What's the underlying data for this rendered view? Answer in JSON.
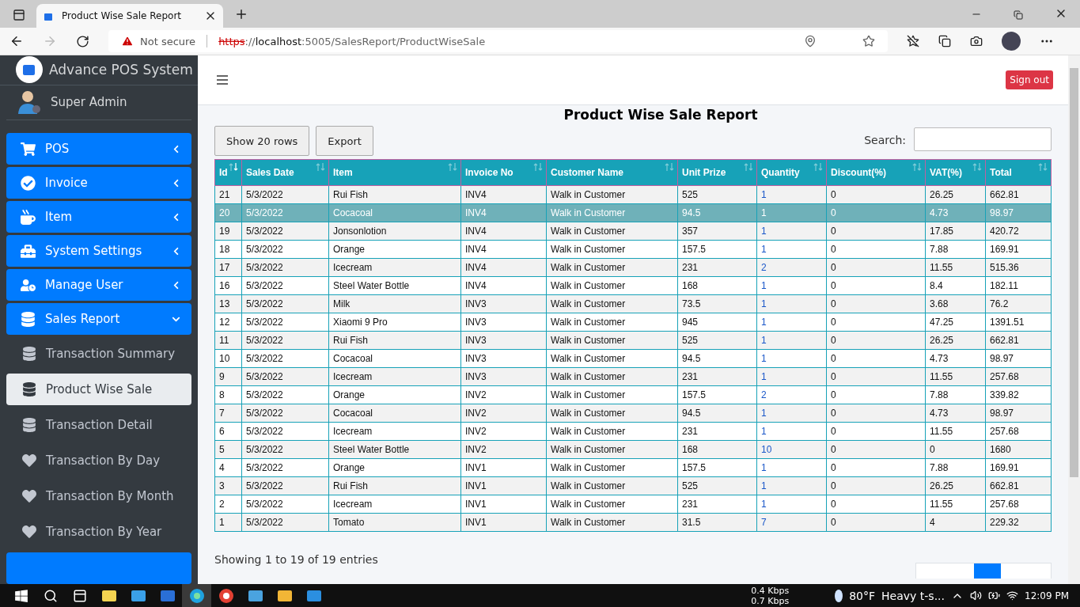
{
  "browser": {
    "tab_title": "Product Wise Sale Report",
    "security": "Not secure",
    "url_scheme": "https",
    "url_sep": "://",
    "url_host": "localhost",
    "url_rest": ":5005/SalesReport/ProductWiseSale"
  },
  "sidebar": {
    "brand": "Advance POS System",
    "user": "Super Admin",
    "menu": [
      {
        "label": "POS",
        "expanded": false
      },
      {
        "label": "Invoice",
        "expanded": false
      },
      {
        "label": "Item",
        "expanded": false
      },
      {
        "label": "System Settings",
        "expanded": false
      },
      {
        "label": "Manage User",
        "expanded": false
      },
      {
        "label": "Sales Report",
        "expanded": true,
        "children": [
          {
            "label": "Transaction Summary",
            "selected": false
          },
          {
            "label": "Product Wise Sale",
            "selected": true
          },
          {
            "label": "Transaction Detail",
            "selected": false
          },
          {
            "label": "Transaction By Day",
            "selected": false
          },
          {
            "label": "Transaction By Month",
            "selected": false
          },
          {
            "label": "Transaction By Year",
            "selected": false
          }
        ]
      }
    ]
  },
  "header": {
    "signout": "Sign out"
  },
  "report": {
    "title": "Product Wise Sale Report",
    "buttons": [
      "Show 20 rows",
      "Export"
    ],
    "search_label": "Search:",
    "columns": [
      {
        "label": "Id",
        "sorted_desc": true
      },
      {
        "label": "Sales Date",
        "sorted_desc": false
      },
      {
        "label": "Item",
        "sorted_desc": false
      },
      {
        "label": "Invoice No",
        "sorted_desc": false
      },
      {
        "label": "Customer Name",
        "sorted_desc": false
      },
      {
        "label": "Unit Prize",
        "sorted_desc": false
      },
      {
        "label": "Quantity",
        "sorted_desc": false
      },
      {
        "label": "Discount(%)",
        "sorted_desc": false
      },
      {
        "label": "VAT(%)",
        "sorted_desc": false
      },
      {
        "label": "Total",
        "sorted_desc": false
      }
    ],
    "rows": [
      {
        "selected": false,
        "cells": [
          "21",
          "5/3/2022",
          "Rui Fish",
          "INV4",
          "Walk in Customer",
          "525",
          "1",
          "0",
          "26.25",
          "662.81"
        ]
      },
      {
        "selected": true,
        "cells": [
          "20",
          "5/3/2022",
          "Cocacoal",
          "INV4",
          "Walk in Customer",
          "94.5",
          "1",
          "0",
          "4.73",
          "98.97"
        ]
      },
      {
        "selected": false,
        "cells": [
          "19",
          "5/3/2022",
          "Jonsonlotion",
          "INV4",
          "Walk in Customer",
          "357",
          "1",
          "0",
          "17.85",
          "420.72"
        ]
      },
      {
        "selected": false,
        "cells": [
          "18",
          "5/3/2022",
          "Orange",
          "INV4",
          "Walk in Customer",
          "157.5",
          "1",
          "0",
          "7.88",
          "169.91"
        ]
      },
      {
        "selected": false,
        "cells": [
          "17",
          "5/3/2022",
          "Icecream",
          "INV4",
          "Walk in Customer",
          "231",
          "2",
          "0",
          "11.55",
          "515.36"
        ]
      },
      {
        "selected": false,
        "cells": [
          "16",
          "5/3/2022",
          "Steel Water Bottle",
          "INV4",
          "Walk in Customer",
          "168",
          "1",
          "0",
          "8.4",
          "182.11"
        ]
      },
      {
        "selected": false,
        "cells": [
          "13",
          "5/3/2022",
          "Milk",
          "INV3",
          "Walk in Customer",
          "73.5",
          "1",
          "0",
          "3.68",
          "76.2"
        ]
      },
      {
        "selected": false,
        "cells": [
          "12",
          "5/3/2022",
          "Xiaomi 9 Pro",
          "INV3",
          "Walk in Customer",
          "945",
          "1",
          "0",
          "47.25",
          "1391.51"
        ]
      },
      {
        "selected": false,
        "cells": [
          "11",
          "5/3/2022",
          "Rui Fish",
          "INV3",
          "Walk in Customer",
          "525",
          "1",
          "0",
          "26.25",
          "662.81"
        ]
      },
      {
        "selected": false,
        "cells": [
          "10",
          "5/3/2022",
          "Cocacoal",
          "INV3",
          "Walk in Customer",
          "94.5",
          "1",
          "0",
          "4.73",
          "98.97"
        ]
      },
      {
        "selected": false,
        "cells": [
          "9",
          "5/3/2022",
          "Icecream",
          "INV3",
          "Walk in Customer",
          "231",
          "1",
          "0",
          "11.55",
          "257.68"
        ]
      },
      {
        "selected": false,
        "cells": [
          "8",
          "5/3/2022",
          "Orange",
          "INV2",
          "Walk in Customer",
          "157.5",
          "2",
          "0",
          "7.88",
          "339.82"
        ]
      },
      {
        "selected": false,
        "cells": [
          "7",
          "5/3/2022",
          "Cocacoal",
          "INV2",
          "Walk in Customer",
          "94.5",
          "1",
          "0",
          "4.73",
          "98.97"
        ]
      },
      {
        "selected": false,
        "cells": [
          "6",
          "5/3/2022",
          "Icecream",
          "INV2",
          "Walk in Customer",
          "231",
          "1",
          "0",
          "11.55",
          "257.68"
        ]
      },
      {
        "selected": false,
        "cells": [
          "5",
          "5/3/2022",
          "Steel Water Bottle",
          "INV2",
          "Walk in Customer",
          "168",
          "10",
          "0",
          "0",
          "1680"
        ]
      },
      {
        "selected": false,
        "cells": [
          "4",
          "5/3/2022",
          "Orange",
          "INV1",
          "Walk in Customer",
          "157.5",
          "1",
          "0",
          "7.88",
          "169.91"
        ]
      },
      {
        "selected": false,
        "cells": [
          "3",
          "5/3/2022",
          "Rui Fish",
          "INV1",
          "Walk in Customer",
          "525",
          "1",
          "0",
          "26.25",
          "662.81"
        ]
      },
      {
        "selected": false,
        "cells": [
          "2",
          "5/3/2022",
          "Icecream",
          "INV1",
          "Walk in Customer",
          "231",
          "1",
          "0",
          "11.55",
          "257.68"
        ]
      },
      {
        "selected": false,
        "cells": [
          "1",
          "5/3/2022",
          "Tomato",
          "INV1",
          "Walk in Customer",
          "31.5",
          "7",
          "0",
          "4",
          "229.32"
        ]
      }
    ],
    "info": "Showing 1 to 19 of 19 entries"
  },
  "taskbar": {
    "download": "0.4 Kbps",
    "upload": "0.7 Kbps",
    "temperature": "80°F",
    "weather": "Heavy t-s...",
    "time": "12:09 PM"
  }
}
